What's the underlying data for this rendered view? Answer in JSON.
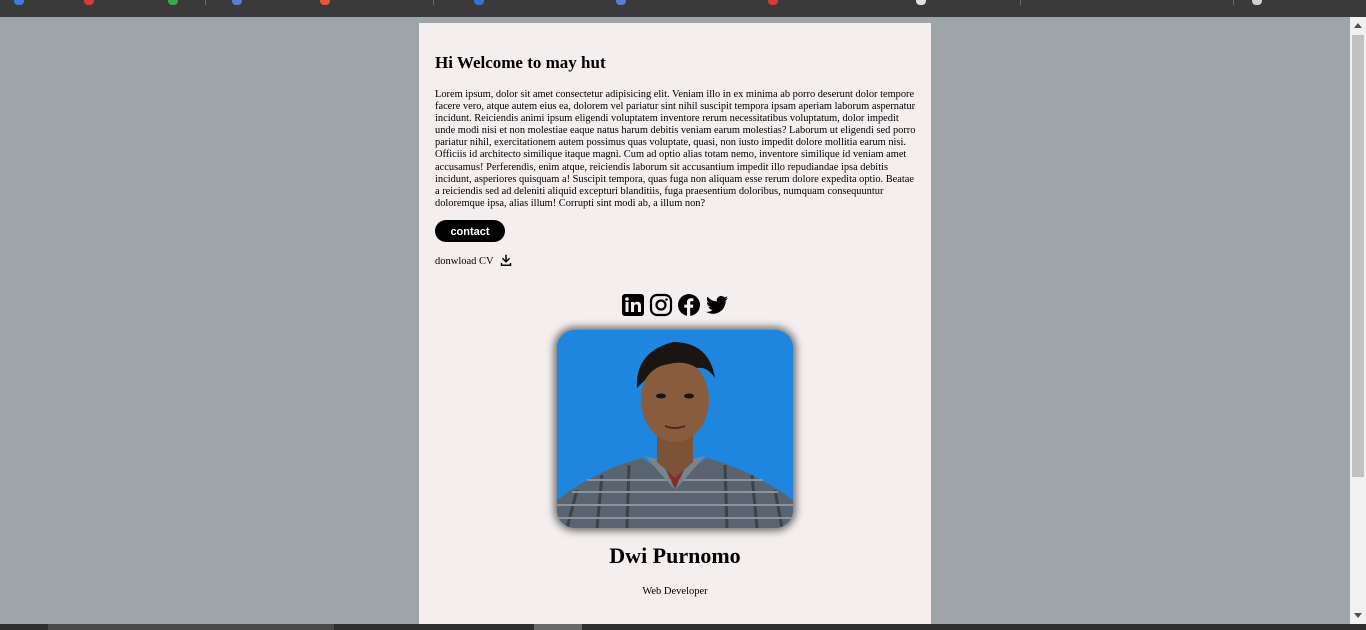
{
  "greeting": "Hi Welcome to may hut",
  "bio": "Lorem ipsum, dolor sit amet consectetur adipisicing elit. Veniam illo in ex minima ab porro deserunt dolor tempore facere vero, atque autem eius ea, dolorem vel pariatur sint nihil suscipit tempora ipsam aperiam laborum aspernatur incidunt. Reiciendis animi ipsum eligendi voluptatem inventore rerum necessitatibus voluptatum, dolor impedit unde modi nisi et non molestiae eaque natus harum debitis veniam earum molestias? Laborum ut eligendi sed porro pariatur nihil, exercitationem autem possimus quas voluptate, quasi, non iusto impedit dolore mollitia earum nisi. Officiis id architecto similique itaque magni. Cum ad optio alias totam nemo, inventore similique id veniam amet accusamus! Perferendis, enim atque, reiciendis laborum sit accusantium impedit illo repudiandae ipsa debitis incidunt, asperiores quisquam a! Suscipit tempora, quas fuga non aliquam esse rerum dolore expedita optio. Beatae a reiciendis sed ad deleniti aliquid excepturi blanditiis, fuga praesentium doloribus, numquam consequuntur doloremque ipsa, alias illum! Corrupti sint modi ab, a illum non?",
  "contact_label": "contact",
  "download_label": "donwload CV",
  "download_icon": "download-icon",
  "socials": [
    "linkedin-icon",
    "instagram-icon",
    "facebook-icon",
    "twitter-icon"
  ],
  "profile": {
    "name": "Dwi Purnomo",
    "role": "Web Developer",
    "photo_bg": "#1e86df"
  },
  "colors": {
    "page_bg": "#9ea5a8",
    "card_bg": "#f4eeee",
    "button_bg": "#000000"
  }
}
